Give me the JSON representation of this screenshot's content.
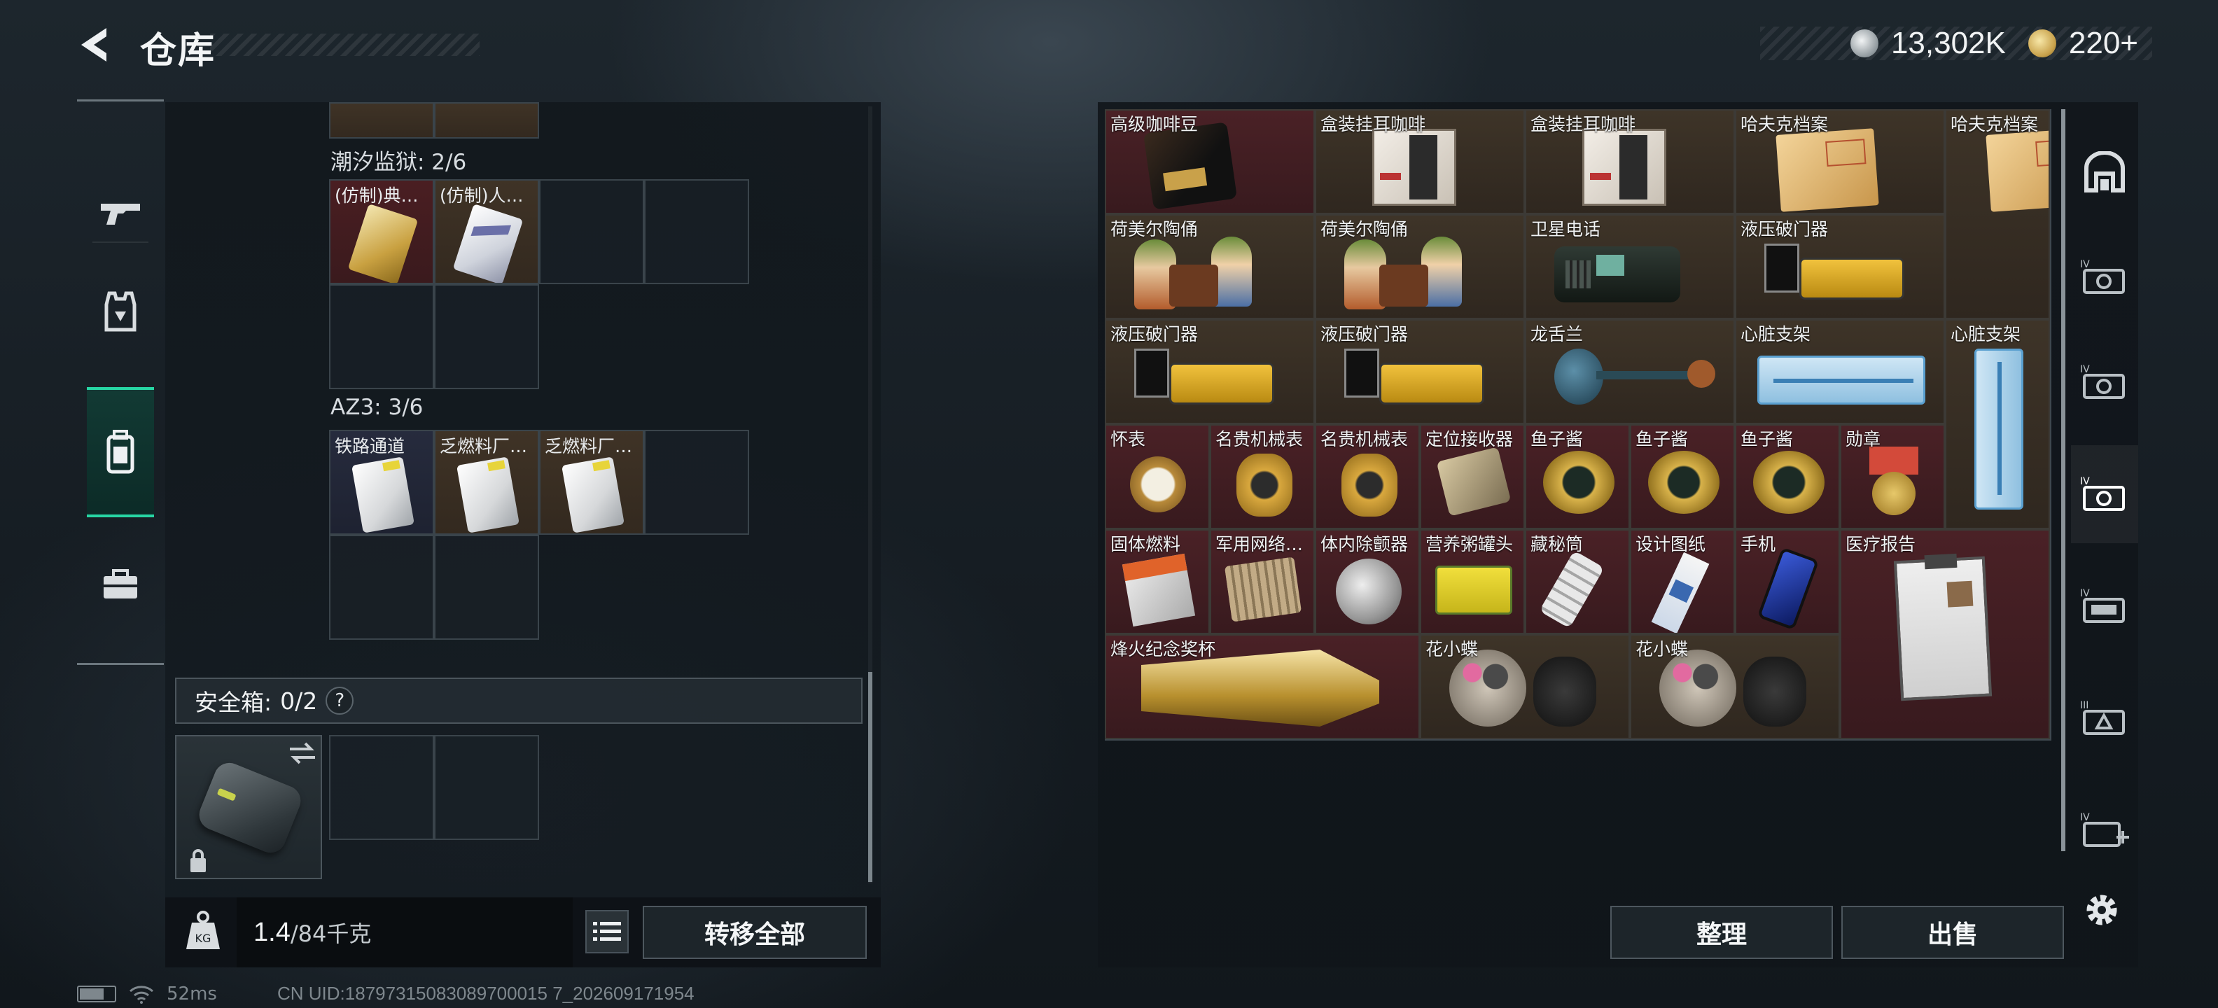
{
  "header": {
    "title": "仓库",
    "currency_silver": "13,302K",
    "currency_gold": "220+"
  },
  "left_nav": [
    "weapon-tab",
    "armor-tab",
    "backpack-tab",
    "case-tab"
  ],
  "container": {
    "sections": [
      {
        "label": "潮汐监狱: 2/6",
        "items": [
          {
            "label": "(仿制)典…",
            "rarity": "red"
          },
          {
            "label": "(仿制)人…",
            "rarity": "brown"
          }
        ]
      },
      {
        "label": "AZ3: 3/6",
        "items": [
          {
            "label": "铁路通道",
            "rarity": "blue"
          },
          {
            "label": "乏燃料厂…",
            "rarity": "brown"
          },
          {
            "label": "乏燃料厂…",
            "rarity": "brown"
          }
        ]
      }
    ],
    "safe_box_label": "安全箱:",
    "safe_box_count": "0/2",
    "help": "?"
  },
  "weight": {
    "current": "1.4",
    "max": "/84千克"
  },
  "buttons": {
    "transfer_all": "转移全部",
    "sort": "整理",
    "sell": "出售"
  },
  "stash_items": [
    {
      "label": "高级咖啡豆",
      "rarity": "red"
    },
    {
      "label": "盒装挂耳咖啡",
      "rarity": "brown"
    },
    {
      "label": "盒装挂耳咖啡",
      "rarity": "brown"
    },
    {
      "label": "哈夫克档案",
      "rarity": "brown"
    },
    {
      "label": "哈夫克档案",
      "rarity": "brown"
    },
    {
      "label": "荷美尔陶俑",
      "rarity": "brown"
    },
    {
      "label": "荷美尔陶俑",
      "rarity": "brown"
    },
    {
      "label": "卫星电话",
      "rarity": "brown"
    },
    {
      "label": "液压破门器",
      "rarity": "brown"
    },
    {
      "label": "液压破门器",
      "rarity": "brown"
    },
    {
      "label": "液压破门器",
      "rarity": "brown"
    },
    {
      "label": "龙舌兰",
      "rarity": "brown"
    },
    {
      "label": "心脏支架",
      "rarity": "brown"
    },
    {
      "label": "心脏支架",
      "rarity": "brown"
    },
    {
      "label": "怀表",
      "rarity": "red"
    },
    {
      "label": "名贵机械表",
      "rarity": "red"
    },
    {
      "label": "名贵机械表",
      "rarity": "red"
    },
    {
      "label": "定位接收器",
      "rarity": "red"
    },
    {
      "label": "鱼子酱",
      "rarity": "red"
    },
    {
      "label": "鱼子酱",
      "rarity": "red"
    },
    {
      "label": "鱼子酱",
      "rarity": "red"
    },
    {
      "label": "勋章",
      "rarity": "red"
    },
    {
      "label": "固体燃料",
      "rarity": "red"
    },
    {
      "label": "军用网络…",
      "rarity": "red"
    },
    {
      "label": "体内除颤器",
      "rarity": "red"
    },
    {
      "label": "营养粥罐头",
      "rarity": "red"
    },
    {
      "label": "藏秘筒",
      "rarity": "red"
    },
    {
      "label": "设计图纸",
      "rarity": "red"
    },
    {
      "label": "手机",
      "rarity": "red"
    },
    {
      "label": "医疗报告",
      "rarity": "red"
    },
    {
      "label": "烽火纪念奖杯",
      "rarity": "red"
    },
    {
      "label": "花小蝶",
      "rarity": "brown"
    },
    {
      "label": "花小蝶",
      "rarity": "brown"
    }
  ],
  "right_rail": [
    "container-tab",
    "case-iv-1",
    "case-iv-2",
    "case-iv-3",
    "case-iv-4",
    "case-iii",
    "case-iv-add"
  ],
  "status": {
    "ping": "52ms",
    "uid": "CN UID:18797315083089700015 7_202609171954"
  },
  "colors": {
    "accent_green": "#27d6a4",
    "rarity_red": "#4a2126",
    "rarity_brown": "#3e3428"
  }
}
